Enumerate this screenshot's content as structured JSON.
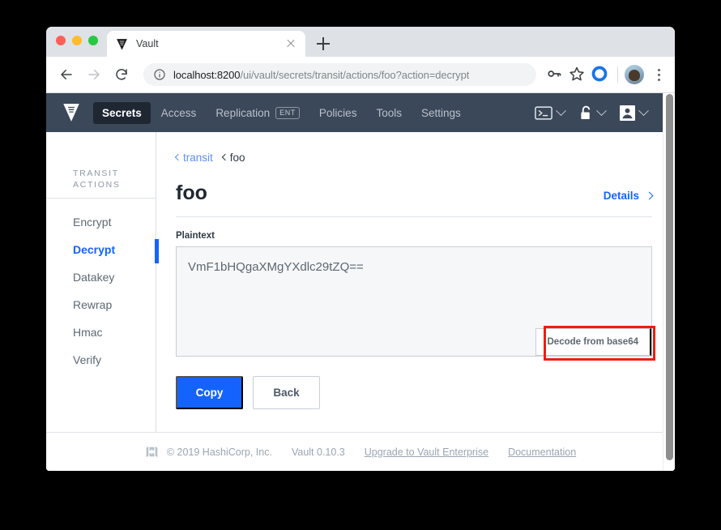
{
  "browser": {
    "tab": {
      "title": "Vault",
      "favicon": "vault-triangle-icon",
      "close": "close-icon"
    },
    "new_tab": "new-tab-icon",
    "nav": {
      "back": "back-arrow-icon",
      "forward": "forward-arrow-icon",
      "reload": "reload-icon"
    },
    "omnibox": {
      "info_icon": "info-circle-icon",
      "host": "localhost:8200",
      "path": "/ui/vault/secrets/transit/actions/foo?action=decrypt"
    },
    "toolbar_icons": [
      "key-icon",
      "star-icon",
      "extension-circle-icon"
    ],
    "avatar": "profile-avatar",
    "menu": "three-dot-menu-icon"
  },
  "vault_nav": {
    "logo": "vault-logo-icon",
    "items": [
      {
        "label": "Secrets",
        "active": true
      },
      {
        "label": "Access",
        "active": false
      },
      {
        "label": "Replication",
        "active": false,
        "badge": "ENT"
      },
      {
        "label": "Policies",
        "active": false
      },
      {
        "label": "Tools",
        "active": false
      },
      {
        "label": "Settings",
        "active": false
      }
    ],
    "right_icons": [
      {
        "name": "console-icon"
      },
      {
        "name": "unlock-icon"
      },
      {
        "name": "user-icon"
      }
    ]
  },
  "sidebar": {
    "heading_line1": "TRANSIT",
    "heading_line2": "ACTIONS",
    "items": [
      {
        "label": "Encrypt",
        "active": false
      },
      {
        "label": "Decrypt",
        "active": true
      },
      {
        "label": "Datakey",
        "active": false
      },
      {
        "label": "Rewrap",
        "active": false
      },
      {
        "label": "Hmac",
        "active": false
      },
      {
        "label": "Verify",
        "active": false
      }
    ]
  },
  "main": {
    "breadcrumb": {
      "parent": "transit",
      "current": "foo"
    },
    "title": "foo",
    "details_label": "Details",
    "field_label": "Plaintext",
    "plaintext_value": "VmF1bHQgaXMgYXdlc29tZQ==",
    "decode_button": "Decode from base64",
    "buttons": {
      "primary": "Copy",
      "secondary": "Back"
    }
  },
  "footer": {
    "logo": "hashicorp-logo-icon",
    "copyright": "© 2019 HashiCorp, Inc.",
    "version": "Vault 0.10.3",
    "upgrade_link": "Upgrade to Vault Enterprise",
    "docs_link": "Documentation"
  },
  "colors": {
    "accent_blue": "#1563ff",
    "navbar": "#3b4859",
    "highlight_red": "#ee1d11"
  }
}
